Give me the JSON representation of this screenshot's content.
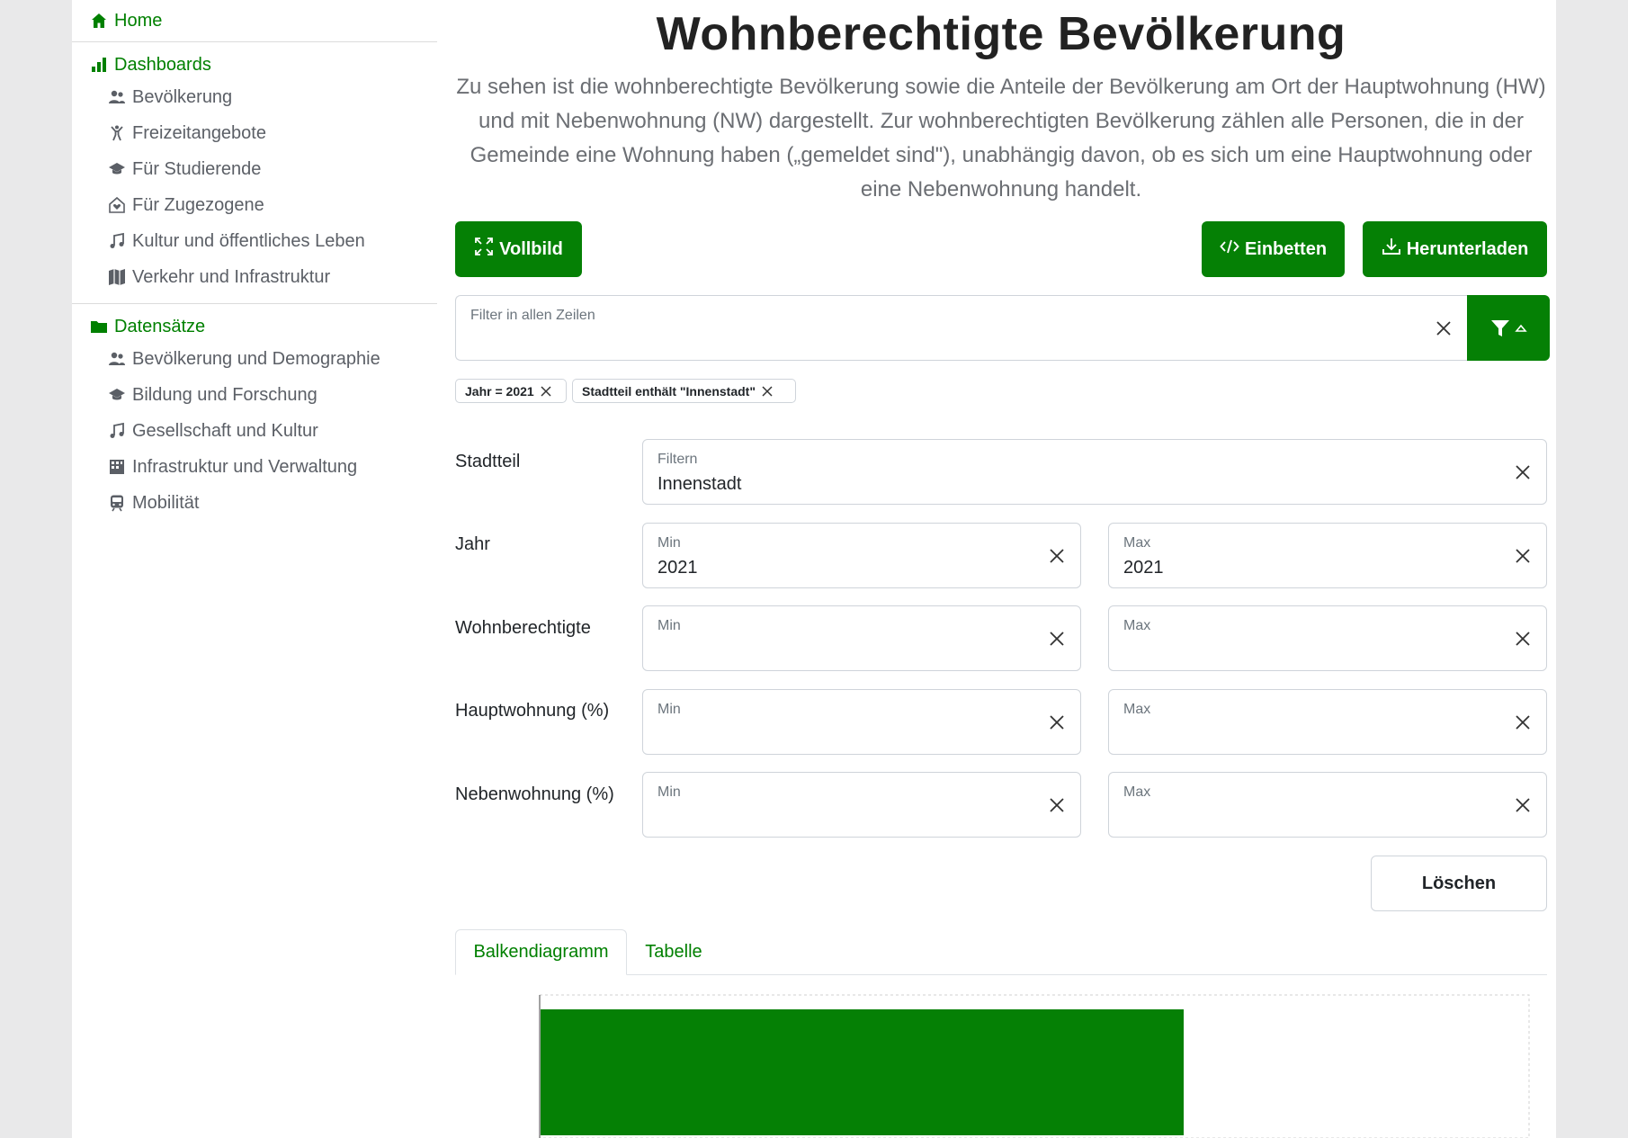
{
  "sidebar": {
    "home": {
      "label": "Home",
      "icon": "home-icon"
    },
    "dashboards": {
      "label": "Dashboards",
      "icon": "bar-chart-icon",
      "items": [
        {
          "label": "Bevölkerung",
          "icon": "people-icon"
        },
        {
          "label": "Freizeitangebote",
          "icon": "person-activity-icon"
        },
        {
          "label": "Für Studierende",
          "icon": "mortarboard-icon"
        },
        {
          "label": "Für Zugezogene",
          "icon": "house-heart-icon"
        },
        {
          "label": "Kultur und öffentliches Leben",
          "icon": "music-note-icon"
        },
        {
          "label": "Verkehr und Infrastruktur",
          "icon": "map-icon"
        }
      ]
    },
    "datasets": {
      "label": "Datensätze",
      "icon": "folder-icon",
      "items": [
        {
          "label": "Bevölkerung und Demographie",
          "icon": "people-icon"
        },
        {
          "label": "Bildung und Forschung",
          "icon": "mortarboard-icon"
        },
        {
          "label": "Gesellschaft und Kultur",
          "icon": "music-note-icon"
        },
        {
          "label": "Infrastruktur und Verwaltung",
          "icon": "building-icon"
        },
        {
          "label": "Mobilität",
          "icon": "train-icon"
        }
      ]
    }
  },
  "main": {
    "title": "Wohnberechtigte Bevölkerung",
    "description": "Zu sehen ist die wohnberechtigte Bevölkerung sowie die Anteile der Bevölkerung am Ort der Hauptwohnung (HW) und mit Nebenwohnung (NW) dargestellt. Zur wohnberechtigten Bevölkerung zählen alle Personen, die in der Gemeinde eine Wohnung haben („gemeldet sind\"), unabhängig davon, ob es sich um eine Hauptwohnung oder eine Nebenwohnung handelt.",
    "buttons": {
      "fullscreen": "Vollbild",
      "embed": "Einbetten",
      "download": "Herunterladen",
      "clear": "Löschen"
    },
    "global_filter": {
      "placeholder": "Filter in allen Zeilen",
      "value": ""
    },
    "active_filters": [
      "Jahr = 2021",
      "Stadtteil enthält \"Innenstadt\""
    ],
    "filters": [
      {
        "label": "Stadtteil",
        "fields": [
          {
            "placeholder": "Filtern",
            "value": "Innenstadt"
          }
        ]
      },
      {
        "label": "Jahr",
        "fields": [
          {
            "placeholder": "Min",
            "value": "2021"
          },
          {
            "placeholder": "Max",
            "value": "2021"
          }
        ]
      },
      {
        "label": "Wohnberechtigte",
        "fields": [
          {
            "placeholder": "Min",
            "value": ""
          },
          {
            "placeholder": "Max",
            "value": ""
          }
        ]
      },
      {
        "label": "Hauptwohnung (%)",
        "fields": [
          {
            "placeholder": "Min",
            "value": ""
          },
          {
            "placeholder": "Max",
            "value": ""
          }
        ]
      },
      {
        "label": "Nebenwohnung (%)",
        "fields": [
          {
            "placeholder": "Min",
            "value": ""
          },
          {
            "placeholder": "Max",
            "value": ""
          }
        ]
      }
    ],
    "tabs": [
      {
        "label": "Balkendiagramm",
        "active": true
      },
      {
        "label": "Tabelle",
        "active": false
      }
    ]
  },
  "colors": {
    "accent": "#058005",
    "link": "#008000",
    "muted_text": "#5b5f66"
  },
  "chart_data": {
    "type": "bar",
    "orientation": "horizontal",
    "note_visible_only": "partially visible bar, values not printed",
    "series": [
      {
        "color": "#058005",
        "values": [
          0.65
        ]
      }
    ]
  }
}
